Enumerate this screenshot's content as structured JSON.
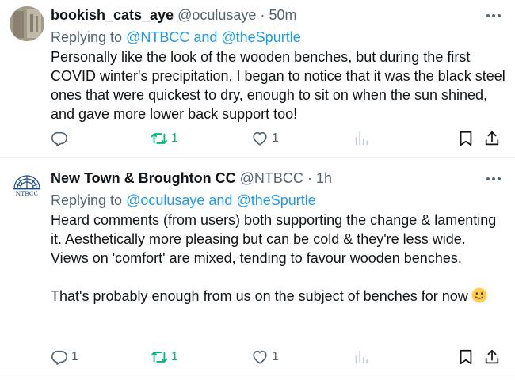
{
  "tweets": [
    {
      "author": "bookish_cats_aye",
      "handle": "@oculusaye",
      "separator": "·",
      "time": "50m",
      "replying_prefix": "Replying to",
      "replying_mentions": "@NTBCC and @theSpurtle",
      "paragraphs": [
        "Personally like the look of the wooden benches, but during the first COVID winter's precipitation, I began to notice that it was the black steel ones that were quickest to dry, enough to sit on when the sun shined, and gave more lower back support too!"
      ],
      "actions": {
        "replies": "",
        "retweets": "1",
        "likes": "1"
      }
    },
    {
      "author": "New Town & Broughton CC",
      "handle": "@NTBCC",
      "separator": "·",
      "time": "1h",
      "avatar_text": "NTBCC",
      "replying_prefix": "Replying to",
      "replying_mentions": "@oculusaye and @theSpurtle",
      "paragraphs": [
        "Heard comments (from users) both supporting the change & lamenting it. Aesthetically more pleasing but can be cold & they're less wide. Views on 'comfort' are mixed, tending to favour wooden benches.",
        "That's probably enough from us on the subject of benches for now"
      ],
      "emoji": "slightly-smiling-face",
      "actions": {
        "replies": "1",
        "retweets": "1",
        "likes": "1"
      }
    }
  ],
  "icons": {
    "reply": "speech-bubble-icon",
    "retweet": "retweet-arrows-icon",
    "like": "heart-icon",
    "views": "bar-chart-icon",
    "bookmark": "bookmark-icon",
    "share": "share-upload-icon",
    "more": "more-dots-icon"
  },
  "colors": {
    "text": "#0f1419",
    "secondary": "#536471",
    "link": "#1d9bf0",
    "retweet_active": "#00ba7c",
    "divider": "#eff3f4"
  }
}
